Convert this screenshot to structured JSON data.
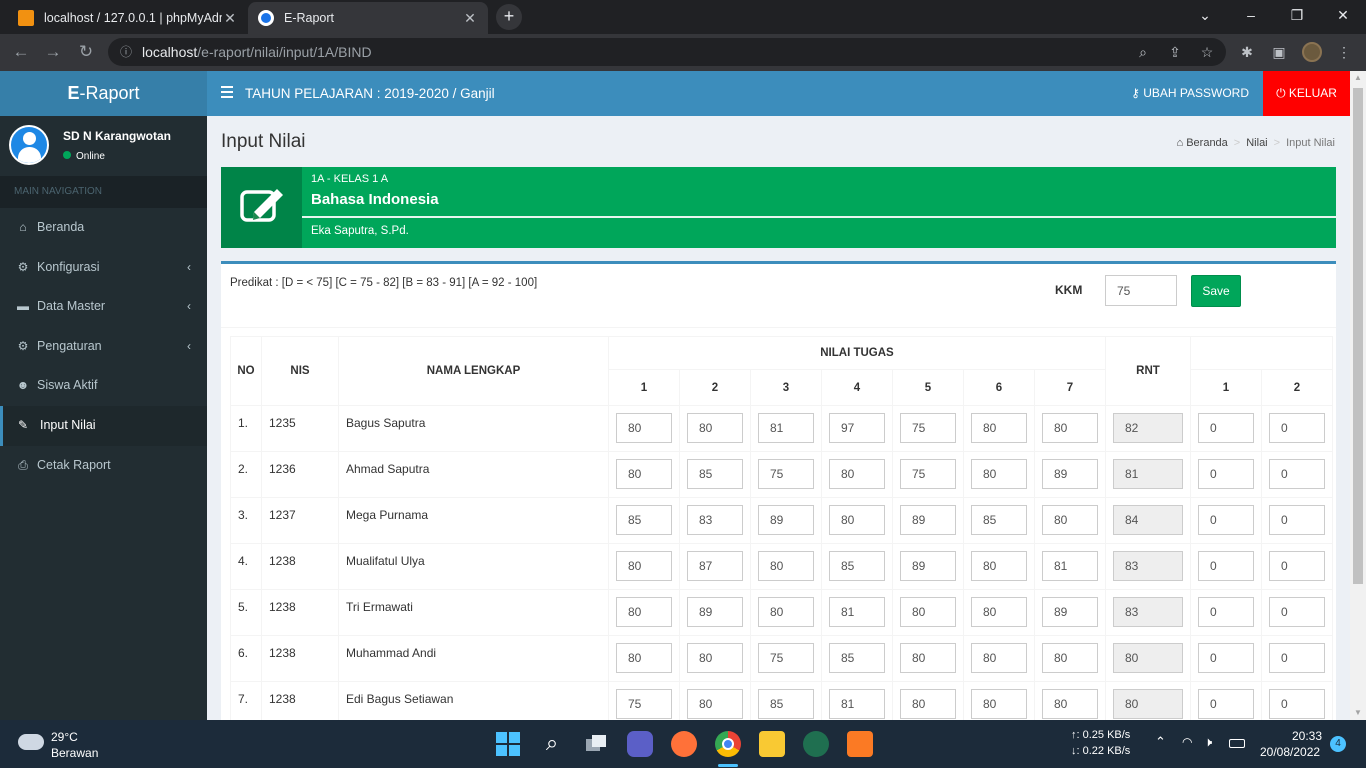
{
  "browser": {
    "tabs": [
      {
        "title": "localhost / 127.0.0.1 | phpMyAdmin",
        "active": false
      },
      {
        "title": "E-Raport",
        "active": true
      }
    ],
    "url_host": "localhost",
    "url_path": "/e-raport/nilai/input/1A/BIND"
  },
  "app": {
    "logo_bold": "E",
    "logo_rest": "-Raport",
    "tahun": "TAHUN PELAJARAN : 2019-2020 / Ganjil",
    "ubah_password": "UBAH PASSWORD",
    "keluar": "KELUAR"
  },
  "sidebar": {
    "school": "SD N Karangwotan",
    "status": "Online",
    "section": "MAIN NAVIGATION",
    "items": [
      {
        "label": "Beranda",
        "icon": "home-icon",
        "glyph": "⌂",
        "has_sub": false,
        "active": false
      },
      {
        "label": "Konfigurasi",
        "icon": "cogs-icon",
        "glyph": "⚙",
        "has_sub": true,
        "active": false
      },
      {
        "label": "Data Master",
        "icon": "folder-icon",
        "glyph": "▬",
        "has_sub": true,
        "active": false
      },
      {
        "label": "Pengaturan",
        "icon": "gear-icon",
        "glyph": "⚙",
        "has_sub": true,
        "active": false
      },
      {
        "label": "Siswa Aktif",
        "icon": "users-icon",
        "glyph": "☻",
        "has_sub": false,
        "active": false
      },
      {
        "label": "Input Nilai",
        "icon": "edit-icon",
        "glyph": "✎",
        "has_sub": false,
        "active": true
      },
      {
        "label": "Cetak Raport",
        "icon": "print-icon",
        "glyph": "⎙",
        "has_sub": false,
        "active": false
      }
    ]
  },
  "page": {
    "title": "Input Nilai",
    "breadcrumb": [
      "Beranda",
      "Nilai",
      "Input Nilai"
    ]
  },
  "info": {
    "kelas": "1A - KELAS 1 A",
    "mapel": "Bahasa Indonesia",
    "guru": "Eka Saputra, S.Pd."
  },
  "form": {
    "predikat": "Predikat : [D = < 75] [C = 75 - 82] [B = 83 - 91] [A = 92 - 100]",
    "kkm_label": "KKM",
    "kkm_value": "75",
    "save_label": "Save"
  },
  "table": {
    "headers": {
      "no": "NO",
      "nis": "NIS",
      "nama": "NAMA LENGKAP",
      "tugas": "NILAI TUGAS",
      "rnt": "RNT"
    },
    "tugas_cols": [
      "1",
      "2",
      "3",
      "4",
      "5",
      "6",
      "7"
    ],
    "extra_cols": [
      "1",
      "2"
    ],
    "rows": [
      {
        "no": "1.",
        "nis": "1235",
        "nama": "Bagus Saputra",
        "tugas": [
          "80",
          "80",
          "81",
          "97",
          "75",
          "80",
          "80"
        ],
        "rnt": "82",
        "extra": [
          "0",
          "0"
        ]
      },
      {
        "no": "2.",
        "nis": "1236",
        "nama": "Ahmad Saputra",
        "tugas": [
          "80",
          "85",
          "75",
          "80",
          "75",
          "80",
          "89"
        ],
        "rnt": "81",
        "extra": [
          "0",
          "0"
        ]
      },
      {
        "no": "3.",
        "nis": "1237",
        "nama": "Mega Purnama",
        "tugas": [
          "85",
          "83",
          "89",
          "80",
          "89",
          "85",
          "80"
        ],
        "rnt": "84",
        "extra": [
          "0",
          "0"
        ]
      },
      {
        "no": "4.",
        "nis": "1238",
        "nama": "Mualifatul Ulya",
        "tugas": [
          "80",
          "87",
          "80",
          "85",
          "89",
          "80",
          "81"
        ],
        "rnt": "83",
        "extra": [
          "0",
          "0"
        ]
      },
      {
        "no": "5.",
        "nis": "1238",
        "nama": "Tri Ermawati",
        "tugas": [
          "80",
          "89",
          "80",
          "81",
          "80",
          "80",
          "89"
        ],
        "rnt": "83",
        "extra": [
          "0",
          "0"
        ]
      },
      {
        "no": "6.",
        "nis": "1238",
        "nama": "Muhammad Andi",
        "tugas": [
          "80",
          "80",
          "75",
          "85",
          "80",
          "80",
          "80"
        ],
        "rnt": "80",
        "extra": [
          "0",
          "0"
        ]
      },
      {
        "no": "7.",
        "nis": "1238",
        "nama": "Edi Bagus Setiawan",
        "tugas": [
          "75",
          "80",
          "85",
          "81",
          "80",
          "80",
          "80"
        ],
        "rnt": "80",
        "extra": [
          "0",
          "0"
        ]
      }
    ]
  },
  "taskbar": {
    "temp": "29°C",
    "weather": "Berawan",
    "net_up": "↑: 0.25 KB/s",
    "net_down": "↓: 0.22 KB/s",
    "time": "20:33",
    "date": "20/08/2022",
    "badge": "4"
  }
}
